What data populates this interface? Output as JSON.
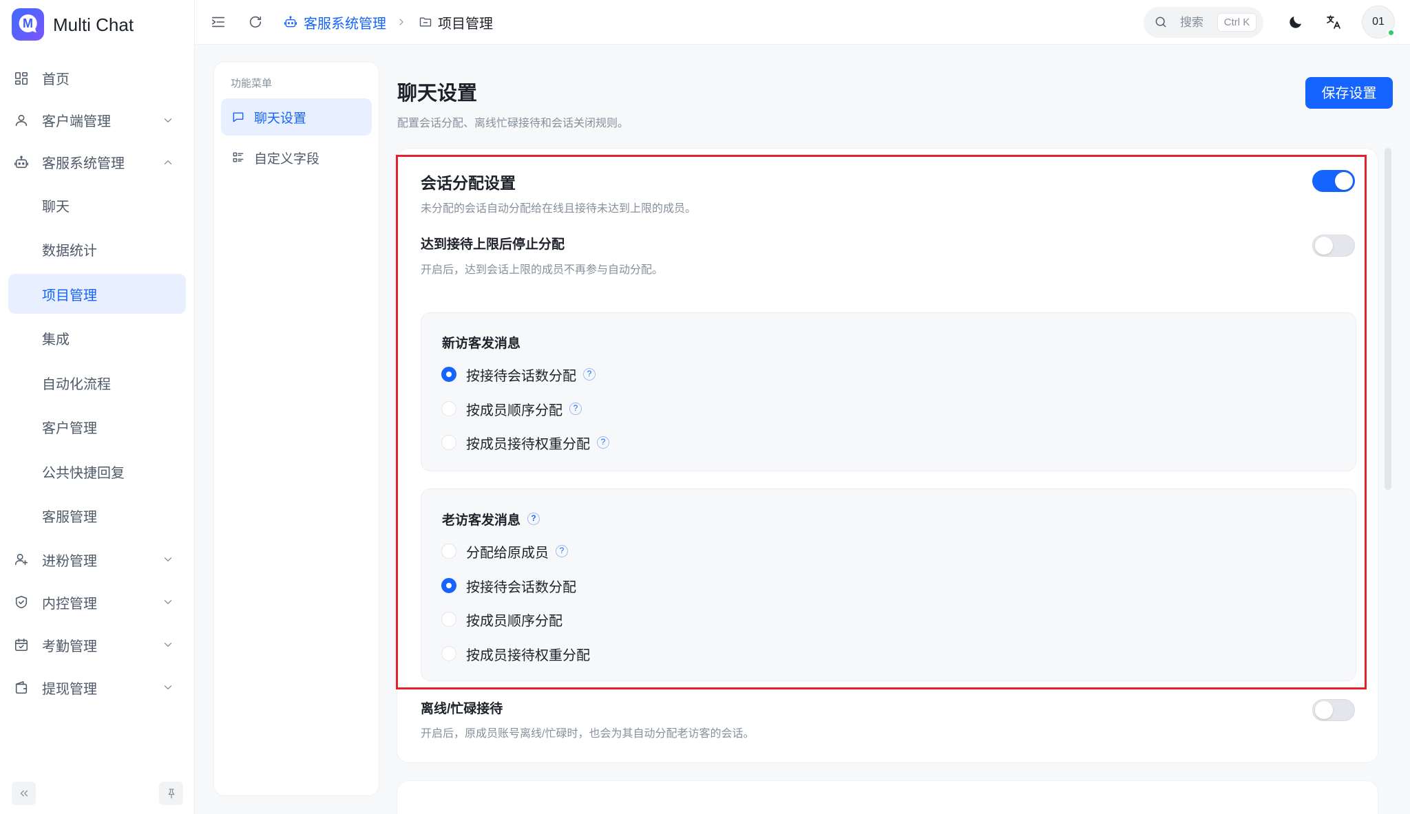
{
  "app": {
    "name": "Multi Chat",
    "logo_letter": "M",
    "logo_icon": "chat-logo-icon"
  },
  "colors": {
    "accent": "#1664ff",
    "accent_soft": "#e8effe",
    "highlight_box": "#e3202c",
    "online": "#2ecc71"
  },
  "sidebar": {
    "items": [
      {
        "label": "首页",
        "icon": "dashboard-icon"
      },
      {
        "label": "客户端管理",
        "icon": "user-icon",
        "expanded": false
      },
      {
        "label": "客服系统管理",
        "icon": "bot-icon",
        "expanded": true,
        "children": [
          {
            "label": "聊天"
          },
          {
            "label": "数据统计"
          },
          {
            "label": "项目管理",
            "active": true
          },
          {
            "label": "集成"
          },
          {
            "label": "自动化流程"
          },
          {
            "label": "客户管理"
          },
          {
            "label": "公共快捷回复"
          },
          {
            "label": "客服管理"
          }
        ]
      },
      {
        "label": "进粉管理",
        "icon": "user-plus-icon",
        "expanded": false
      },
      {
        "label": "内控管理",
        "icon": "shield-icon",
        "expanded": false
      },
      {
        "label": "考勤管理",
        "icon": "calendar-check-icon",
        "expanded": false
      },
      {
        "label": "提现管理",
        "icon": "wallet-icon",
        "expanded": false
      }
    ],
    "footer": {
      "collapse_icon": "double-chevron-left-icon",
      "pin_icon": "pin-icon"
    }
  },
  "header": {
    "menu_icon": "menu-fold-icon",
    "refresh_icon": "refresh-icon",
    "breadcrumb": [
      {
        "label": "客服系统管理",
        "icon": "bot-icon"
      },
      {
        "label": "项目管理",
        "icon": "folder-icon"
      }
    ],
    "search": {
      "placeholder": "搜索",
      "shortcut": "Ctrl K",
      "icon": "search-icon"
    },
    "theme_icon": "moon-icon",
    "language_icon": "translate-icon",
    "user": {
      "avatar_text": "01",
      "online": true
    }
  },
  "submenu": {
    "title": "功能菜单",
    "items": [
      {
        "label": "聊天设置",
        "icon": "chat-bubble-icon",
        "active": true
      },
      {
        "label": "自定义字段",
        "icon": "list-icon",
        "active": false
      }
    ]
  },
  "page": {
    "title": "聊天设置",
    "subtitle": "配置会话分配、离线忙碌接待和会话关闭规则。",
    "save_label": "保存设置"
  },
  "settings": {
    "assignment": {
      "title": "会话分配设置",
      "description": "未分配的会话自动分配给在线且接待未达到上限的成员。",
      "enabled": true
    },
    "stop_at_limit": {
      "title": "达到接待上限后停止分配",
      "description": "开启后，达到会话上限的成员不再参与自动分配。",
      "enabled": false
    },
    "new_visitor": {
      "title": "新访客发消息",
      "title_help": false,
      "options": [
        {
          "label": "按接待会话数分配",
          "help": true,
          "checked": true
        },
        {
          "label": "按成员顺序分配",
          "help": true,
          "checked": false
        },
        {
          "label": "按成员接待权重分配",
          "help": true,
          "checked": false
        }
      ]
    },
    "returning_visitor": {
      "title": "老访客发消息",
      "title_help": true,
      "options": [
        {
          "label": "分配给原成员",
          "help": true,
          "checked": false
        },
        {
          "label": "按接待会话数分配",
          "help": false,
          "checked": true
        },
        {
          "label": "按成员顺序分配",
          "help": false,
          "checked": false
        },
        {
          "label": "按成员接待权重分配",
          "help": false,
          "checked": false
        }
      ]
    },
    "offline_busy": {
      "title": "离线/忙碌接待",
      "description": "开启后，原成员账号离线/忙碌时，也会为其自动分配老访客的会话。",
      "enabled": false
    }
  }
}
